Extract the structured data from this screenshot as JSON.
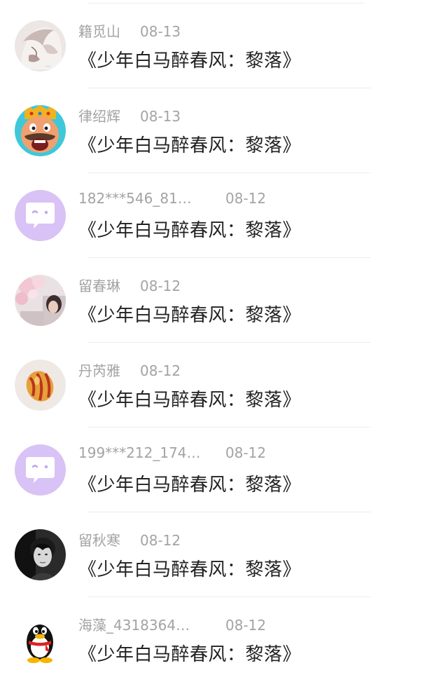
{
  "comments": [
    {
      "name": "籍觅山",
      "date": "08-13",
      "title": "《少年白马醉春风：黎落》",
      "avatar": "anime-sketch-avatar",
      "long": false
    },
    {
      "name": "律绍辉",
      "date": "08-13",
      "title": "《少年白马醉春风：黎落》",
      "avatar": "clash-king-avatar",
      "long": false
    },
    {
      "name": "182***546_81…",
      "date": "08-12",
      "title": "《少年白马醉春风：黎落》",
      "avatar": "default-chat-avatar",
      "long": true
    },
    {
      "name": "留春琳",
      "date": "08-12",
      "title": "《少年白马醉春风：黎落》",
      "avatar": "pink-flowers-avatar",
      "long": false
    },
    {
      "name": "丹芮雅",
      "date": "08-12",
      "title": "《少年白马醉春风：黎落》",
      "avatar": "striped-ball-avatar",
      "long": false
    },
    {
      "name": "199***212_174…",
      "date": "08-12",
      "title": "《少年白马醉春风：黎落》",
      "avatar": "default-chat-avatar",
      "long": true
    },
    {
      "name": "留秋寒",
      "date": "08-12",
      "title": "《少年白马醉春风：黎落》",
      "avatar": "portrait-photo-avatar",
      "long": false
    },
    {
      "name": "海藻_4318364…",
      "date": "08-12",
      "title": "《少年白马醉春风：黎落》",
      "avatar": "qq-penguin-avatar",
      "long": true
    }
  ],
  "colors": {
    "meta_text": "#a3a3a3",
    "title_text": "#222222",
    "default_avatar_bg": "#d9c2f5",
    "divider": "#ededed"
  }
}
